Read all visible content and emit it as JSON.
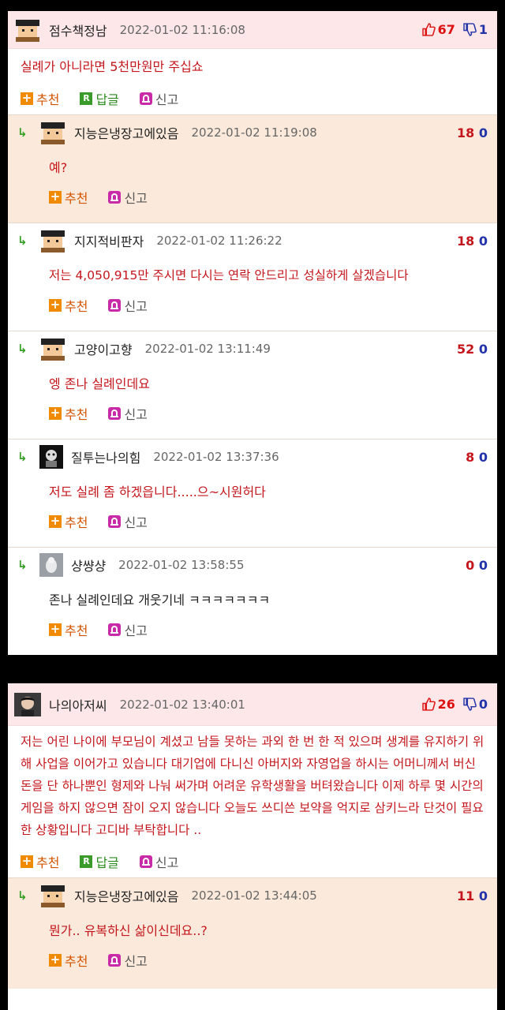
{
  "labels": {
    "recommend": "추천",
    "reply": "답글",
    "report": "신고"
  },
  "panel1": {
    "post": {
      "nick": "점수책정남",
      "date": "2022-01-02 11:16:08",
      "up": "67",
      "down": "1",
      "text": "실례가 아니라면 5천만원만 주십쇼"
    },
    "replies": [
      {
        "nick": "지능은냉장고에있음",
        "date": "2022-01-02 11:19:08",
        "up": "18",
        "down": "0",
        "text": "예?"
      },
      {
        "nick": "지지적비판자",
        "date": "2022-01-02 11:26:22",
        "up": "18",
        "down": "0",
        "text": "저는 4,050,915만 주시면 다시는 연락 안드리고 성실하게 살겠습니다"
      },
      {
        "nick": "고양이고향",
        "date": "2022-01-02 13:11:49",
        "up": "52",
        "down": "0",
        "text": "엥 존나 실례인데요"
      },
      {
        "nick": "질투는나의힘",
        "date": "2022-01-02 13:37:36",
        "up": "8",
        "down": "0",
        "text": "저도 실례 좀 하겠읍니다.....으~시원허다"
      },
      {
        "nick": "샹썅샹",
        "date": "2022-01-02 13:58:55",
        "up": "0",
        "down": "0",
        "text": "존나 실례인데요 개웃기네 ㅋㅋㅋㅋㅋㅋㅋ"
      }
    ]
  },
  "panel2": {
    "post": {
      "nick": "나의아저씨",
      "date": "2022-01-02 13:40:01",
      "up": "26",
      "down": "0",
      "text": "저는 어린 나이에 부모님이 계셨고 남들 못하는 과외 한 번 한 적 있으며 생계를 유지하기 위해 사업을 이어가고 있습니다 대기업에 다니신 아버지와 자영업을 하시는 어머니께서 버신 돈을 단 하나뿐인 형제와 나눠 써가며 어려운 유학생활을 버텨왔습니다 이제 하루 몇 시간의 게임을 하지 않으면 잠이 오지 않습니다 오늘도 쓰디쓴 보약을 억지로 삼키느라 단것이 필요한 상황입니다 고디바 부탁합니다 .."
    },
    "replies": [
      {
        "nick": "지능은냉장고에있음",
        "date": "2022-01-02 13:44:05",
        "up": "11",
        "down": "0",
        "text": "뭔가.. 유복하신 삶이신데요..?"
      }
    ]
  }
}
